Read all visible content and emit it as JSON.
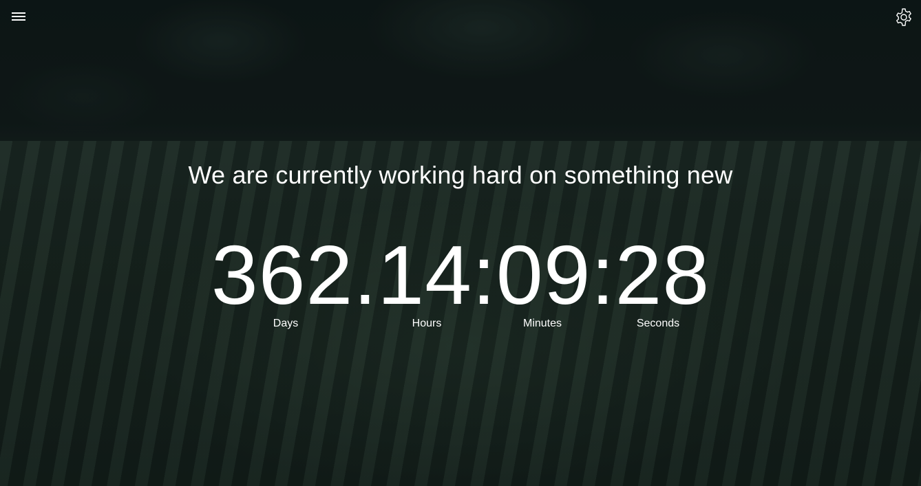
{
  "header": {
    "menu_icon": "hamburger-menu-icon",
    "settings_icon": "gear-icon"
  },
  "headline": "We are currently working hard on something new",
  "countdown": {
    "display": "362.14:09:28",
    "days": "362",
    "hours": "14",
    "minutes": "09",
    "seconds": "28",
    "labels": {
      "days": "Days",
      "hours": "Hours",
      "minutes": "Minutes",
      "seconds": "Seconds"
    }
  },
  "colors": {
    "text": "#ffffff",
    "background": "#1a2320"
  }
}
